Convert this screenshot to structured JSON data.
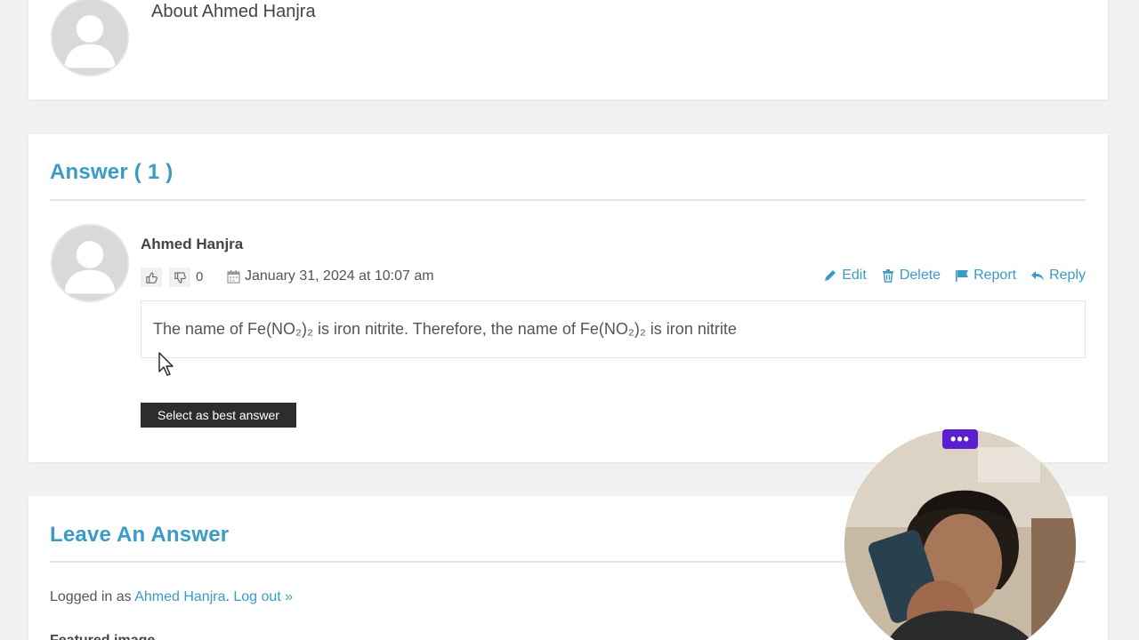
{
  "about": {
    "title": "About Ahmed Hanjra"
  },
  "answers": {
    "title": "Answer ( 1 )",
    "items": [
      {
        "author": "Ahmed Hanjra",
        "votes": "0",
        "date": "January 31, 2024 at 10:07 am",
        "body": "The name of Fe(NO₂)₂ is iron nitrite. Therefore, the name of Fe(NO₂)₂ is iron nitrite",
        "actions": {
          "edit": "Edit",
          "delete": "Delete",
          "report": "Report",
          "reply": "Reply"
        },
        "best_answer_label": "Select as best answer"
      }
    ]
  },
  "leave_answer": {
    "title": "Leave An Answer",
    "logged_in_prefix": "Logged in as ",
    "user_link": "Ahmed Hanjra",
    "separator": ". ",
    "logout_link": "Log out »",
    "next_label_partial": "Featured image"
  },
  "webcam": {
    "menu_label": "•••"
  },
  "colors": {
    "accent": "#3b9bc7",
    "button_dark": "#2d2d2d",
    "webcam_menu": "#5b1fd1",
    "page_bg": "#f1f1f1"
  }
}
